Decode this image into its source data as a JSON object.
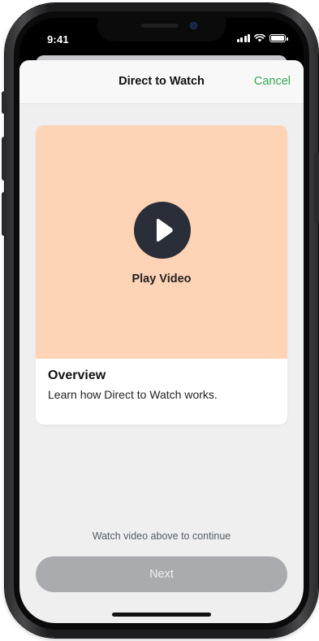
{
  "status_bar": {
    "time": "9:41"
  },
  "header": {
    "title": "Direct to Watch",
    "cancel_label": "Cancel"
  },
  "video_card": {
    "play_label": "Play Video",
    "title": "Overview",
    "description": "Learn how Direct to Watch works."
  },
  "footer": {
    "hint": "Watch video above to continue",
    "next_label": "Next"
  },
  "colors": {
    "accent": "#34a853",
    "video_bg": "#ffd3b6",
    "play_button": "#2a2e38",
    "disabled_button": "#a9abae"
  },
  "icons": [
    "signal-icon",
    "wifi-icon",
    "battery-icon",
    "play-icon"
  ]
}
